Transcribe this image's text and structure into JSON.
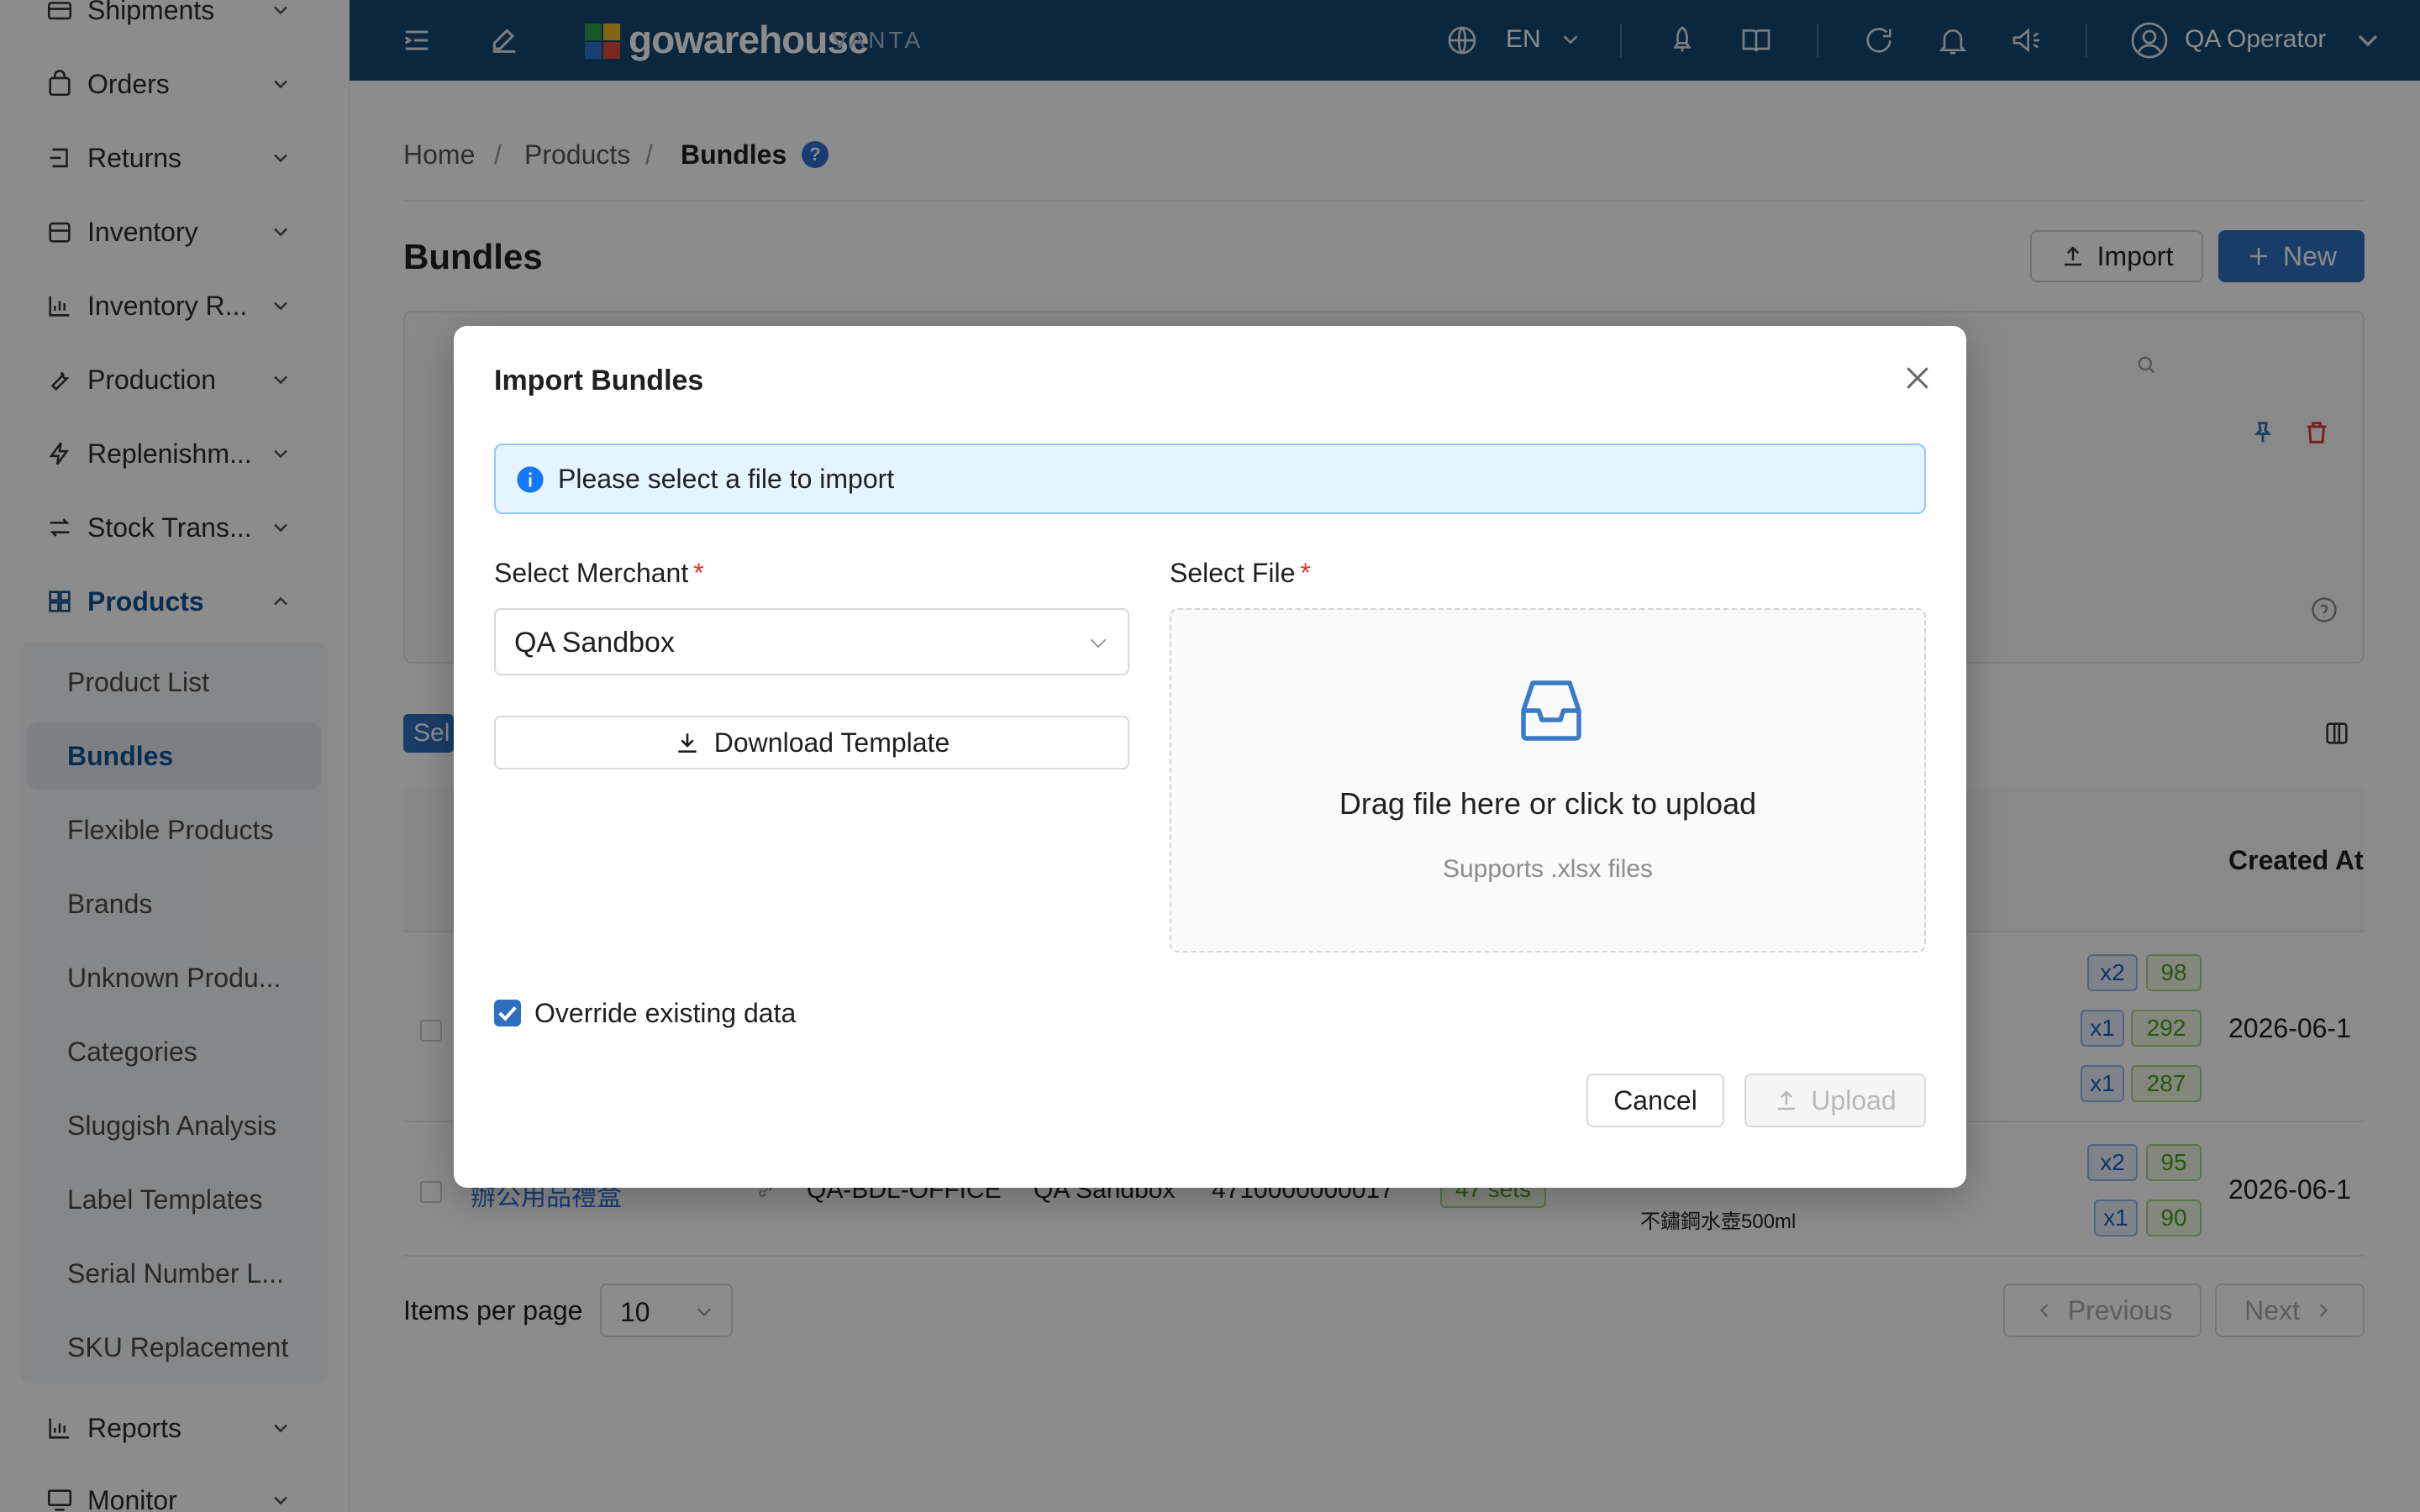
{
  "sidebar": {
    "items": [
      {
        "label": "Shipments"
      },
      {
        "label": "Orders"
      },
      {
        "label": "Returns"
      },
      {
        "label": "Inventory"
      },
      {
        "label": "Inventory R..."
      },
      {
        "label": "Production"
      },
      {
        "label": "Replenishm..."
      },
      {
        "label": "Stock Trans..."
      },
      {
        "label": "Products"
      },
      {
        "label": "Reports"
      },
      {
        "label": "Monitor"
      }
    ],
    "products_submenu": [
      {
        "label": "Product List"
      },
      {
        "label": "Bundles"
      },
      {
        "label": "Flexible Products"
      },
      {
        "label": "Brands"
      },
      {
        "label": "Unknown Produ..."
      },
      {
        "label": "Categories"
      },
      {
        "label": "Sluggish Analysis"
      },
      {
        "label": "Label Templates"
      },
      {
        "label": "Serial Number L..."
      },
      {
        "label": "SKU Replacement"
      }
    ]
  },
  "topbar": {
    "brand": "gowarehouse",
    "brand_sub": "VANTA",
    "language": "EN",
    "user": "QA Operator",
    "brand_color": "#14486f"
  },
  "breadcrumb": {
    "home": "Home",
    "products": "Products",
    "current": "Bundles",
    "sep1": "/",
    "sep2": "/",
    "help": "?"
  },
  "page": {
    "title": "Bundles",
    "import_label": "Import",
    "new_label": "New",
    "select_partial": "Sel"
  },
  "table": {
    "created_at_header": "Created At",
    "rows": [
      {
        "created": "2026-06-1",
        "tags": [
          [
            "x2",
            "98"
          ],
          [
            "x1",
            "292"
          ],
          [
            "x1",
            "287"
          ]
        ]
      },
      {
        "name": "辦公用品禮盒",
        "sku": "QA-BDL-OFFICE",
        "merchant": "QA Sandbox",
        "barcode": "4710000000017",
        "sets": "47 sets",
        "component": "不鏽鋼水壺500ml",
        "created": "2026-06-1",
        "tags": [
          [
            "x2",
            "95"
          ],
          [
            "x1",
            "90"
          ]
        ]
      }
    ]
  },
  "pagination": {
    "items_per_page_label": "Items per page",
    "page_size": "10",
    "previous": "Previous",
    "next": "Next"
  },
  "modal": {
    "title": "Import Bundles",
    "alert": "Please select a file to import",
    "merchant_label": "Select Merchant",
    "merchant_value": "QA Sandbox",
    "file_label": "Select File",
    "required_mark": "*",
    "download_template": "Download Template",
    "dropzone_main": "Drag file here or click to upload",
    "dropzone_hint": "Supports .xlsx files",
    "override_label": "Override existing data",
    "override_checked": true,
    "cancel": "Cancel",
    "upload": "Upload"
  }
}
